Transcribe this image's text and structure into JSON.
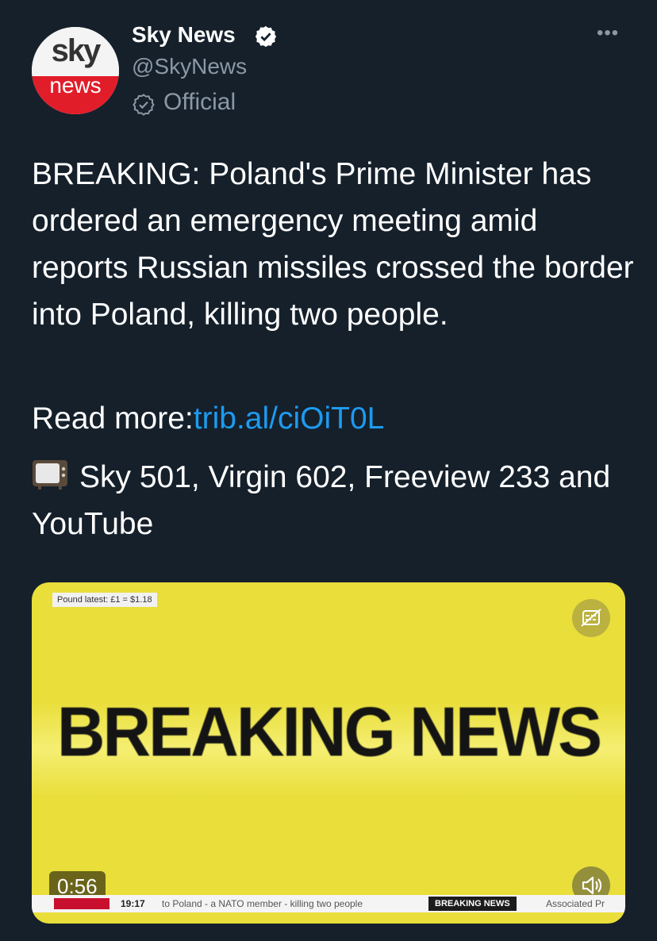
{
  "account": {
    "display_name": "Sky News",
    "handle": "@SkyNews",
    "label": "Official",
    "avatar_text_top": "sky",
    "avatar_text_bottom": "news"
  },
  "menu": {
    "more_label": "•••"
  },
  "tweet": {
    "text": "BREAKING: Poland's Prime Minister has ordered an emergency meeting amid reports Russian missiles crossed the border into Poland, killing two people.",
    "read_more_prefix": "Read more:",
    "link": "trib.al/ciOiT0L",
    "channels": "Sky 501, Virgin 602, Freeview 233 and YouTube"
  },
  "media": {
    "headline": "BREAKING NEWS",
    "pound_latest": "Pound latest: £1 = $1.18",
    "duration": "0:56",
    "ticker_time": "19:17",
    "ticker_text": "to Poland - a NATO member - killing two people",
    "ticker_badge": "BREAKING NEWS",
    "ticker_source": "Associated Pr"
  },
  "colors": {
    "background": "#15202b",
    "link": "#1d9bf0",
    "secondary_text": "#8b98a5",
    "video_yellow": "#e9de3a",
    "sky_red": "#e11d2a"
  },
  "icons": [
    "verified-badge-icon",
    "official-badge-icon",
    "more-icon",
    "tv-icon",
    "captions-icon",
    "volume-icon"
  ]
}
